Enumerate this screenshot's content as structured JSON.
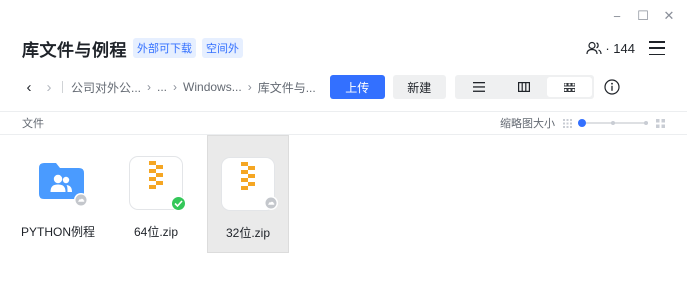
{
  "window": {
    "controls": [
      "−",
      "☐",
      "✕"
    ]
  },
  "header": {
    "title": "库文件与例程",
    "tags": [
      "外部可下载",
      "空间外"
    ],
    "member_count": "· 144"
  },
  "nav": {
    "back": "‹",
    "forward": "›",
    "crumbs": [
      "公司对外公...",
      "...",
      "Windows...",
      "库文件与..."
    ],
    "crumb_sep": "›",
    "upload_label": "上传",
    "new_label": "新建"
  },
  "section": {
    "label": "文件",
    "thumb_size_label": "缩略图大小"
  },
  "colors": {
    "accent": "#3370ff",
    "folder": "#4a9bff",
    "zip_stripe": "#f5a623",
    "synced": "#34c759"
  },
  "files": [
    {
      "name": "PYTHON例程",
      "type": "folder",
      "status": "cloud"
    },
    {
      "name": "64位.zip",
      "type": "zip",
      "status": "synced"
    },
    {
      "name": "32位.zip",
      "type": "zip",
      "status": "cloud"
    }
  ]
}
